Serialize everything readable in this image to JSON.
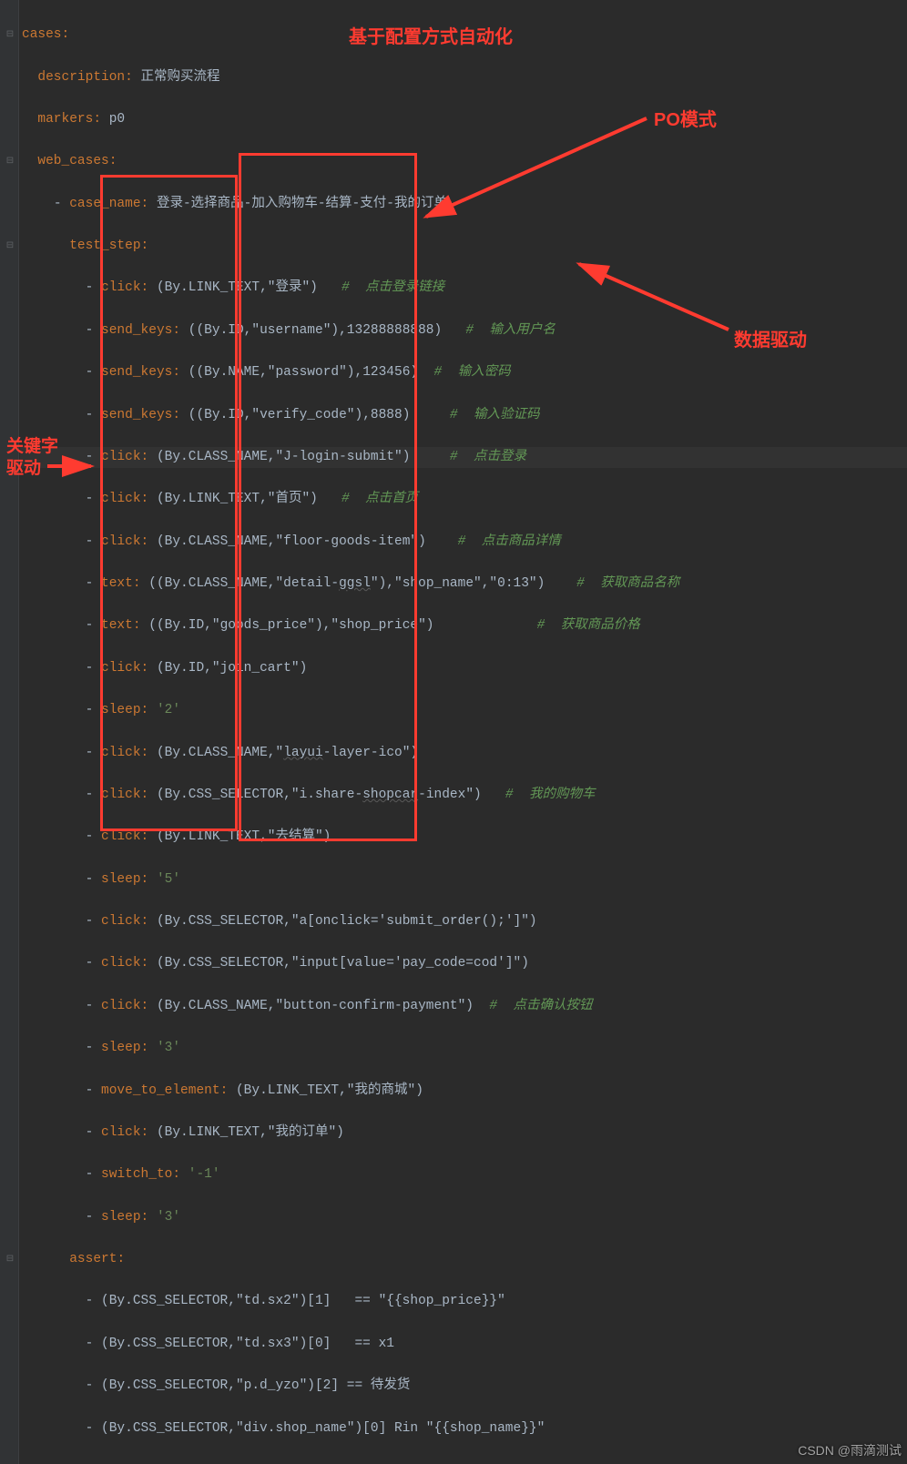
{
  "annotations": {
    "title1": "基于配置方式自动化",
    "title2": "PO模式",
    "title3": "数据驱动",
    "title4_l1": "关键字",
    "title4_l2": "驱动"
  },
  "watermark": "CSDN @雨滴测试",
  "code": {
    "l1_key": "cases",
    "l2_key": "description",
    "l2_val": "正常购买流程",
    "l3_key": "markers",
    "l3_val": "p0",
    "l4_key": "web_cases",
    "l5_key": "case_name",
    "l5_val": "登录-选择商品-加入购物车-结算-支付-我的订单",
    "l6_key": "test_step",
    "l7_k": "click",
    "l7_v": "(By.LINK_TEXT,\"登录\")",
    "l7_c": "#  点击登录链接",
    "l8_k": "send_keys",
    "l8_v": "((By.ID,\"username\"),13288888888)",
    "l8_c": "#  输入用户名",
    "l9_k": "send_keys",
    "l9_v": "((By.NAME,\"password\"),123456)",
    "l9_c": "#  输入密码",
    "l10_k": "send_keys",
    "l10_v": "((By.ID,\"verify_code\"),8888)",
    "l10_c": "#  输入验证码",
    "l11_k": "click",
    "l11_v": "(By.CLASS_NAME,\"J-login-submit\")",
    "l11_c": "#  点击登录",
    "l12_k": "click",
    "l12_v": "(By.LINK_TEXT,\"首页\")",
    "l12_c": "#  点击首页",
    "l13_k": "click",
    "l13_v": "(By.CLASS_NAME,\"floor-goods-item\")",
    "l13_c": "#  点击商品详情",
    "l14_k": "text",
    "l14_v": "((By.CLASS_NAME,\"detail-",
    "l14_u": "ggsl",
    "l14_v2": "\"),\"shop_name\",\"0:13\")",
    "l14_c": "#  获取商品名称",
    "l15_k": "text",
    "l15_v": "((By.ID,\"goods_price\"),\"shop_price\")",
    "l15_c": "#  获取商品价格",
    "l16_k": "click",
    "l16_v": "(By.ID,\"join_cart\")",
    "l17_k": "sleep",
    "l17_v": "'2'",
    "l18_k": "click",
    "l18_v": "(By.CLASS_NAME,\"",
    "l18_u": "layui",
    "l18_v2": "-layer-ico\")",
    "l19_k": "click",
    "l19_v": "(By.CSS_SELECTOR,\"i.share-",
    "l19_u": "shopcar",
    "l19_v2": "-index\")",
    "l19_c": "#  我的购物车",
    "l20_k": "click",
    "l20_v": "(By.LINK_TEXT,\"去结算\")",
    "l21_k": "sleep",
    "l21_v": "'5'",
    "l22_k": "click",
    "l22_v": "(By.CSS_SELECTOR,\"a[onclick='submit_order();']\")",
    "l23_k": "click",
    "l23_v": "(By.CSS_SELECTOR,\"input[value='pay_code=cod']\")",
    "l24_k": "click",
    "l24_v": "(By.CLASS_NAME,\"button-confirm-payment\")",
    "l24_c": "#  点击确认按钮",
    "l25_k": "sleep",
    "l25_v": "'3'",
    "l26_k": "move_to_element",
    "l26_v": "(By.LINK_TEXT,\"我的商城\")",
    "l27_k": "click",
    "l27_v": "(By.LINK_TEXT,\"我的订单\")",
    "l28_k": "switch_to",
    "l28_v": "'-1'",
    "l29_k": "sleep",
    "l29_v": "'3'",
    "l30_key": "assert",
    "l31": "(By.CSS_SELECTOR,\"td.sx2\")[1]   == \"{{shop_price}}\"",
    "l32": "(By.CSS_SELECTOR,\"td.sx3\")[0]   == x1",
    "l33": "(By.CSS_SELECTOR,\"p.d_yzo\")[2] == 待发货",
    "l34": "(By.CSS_SELECTOR,\"div.shop_name\")[0] Rin \"{{shop_name}}\""
  }
}
